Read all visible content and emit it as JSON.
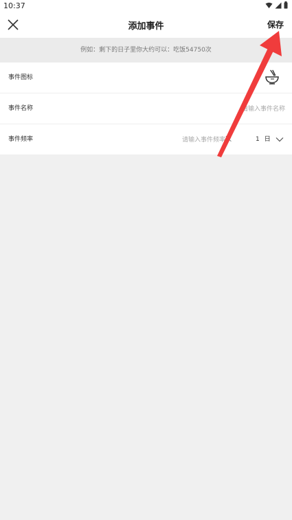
{
  "status_bar": {
    "time": "10:37",
    "icons": [
      "wifi-icon",
      "signal-icon",
      "battery-icon"
    ]
  },
  "header": {
    "close_icon": "close-icon",
    "title": "添加事件",
    "save_label": "保存"
  },
  "hint": {
    "text": "例如：剩下的日子里你大约可以：吃饭54750次"
  },
  "form": {
    "icon_row": {
      "label": "事件图标",
      "icon": "rice-bowl-icon"
    },
    "name_row": {
      "label": "事件名称",
      "placeholder": "请输入事件名称",
      "value": ""
    },
    "frequency_row": {
      "label": "事件频率",
      "placeholder": "请输入事件频率",
      "value": "",
      "unit": "次",
      "period_count": "1",
      "period_unit": "日",
      "dropdown_icon": "chevron-down-icon"
    }
  },
  "annotation": {
    "type": "red-arrow",
    "target": "save-button",
    "color": "#f03c3c"
  }
}
